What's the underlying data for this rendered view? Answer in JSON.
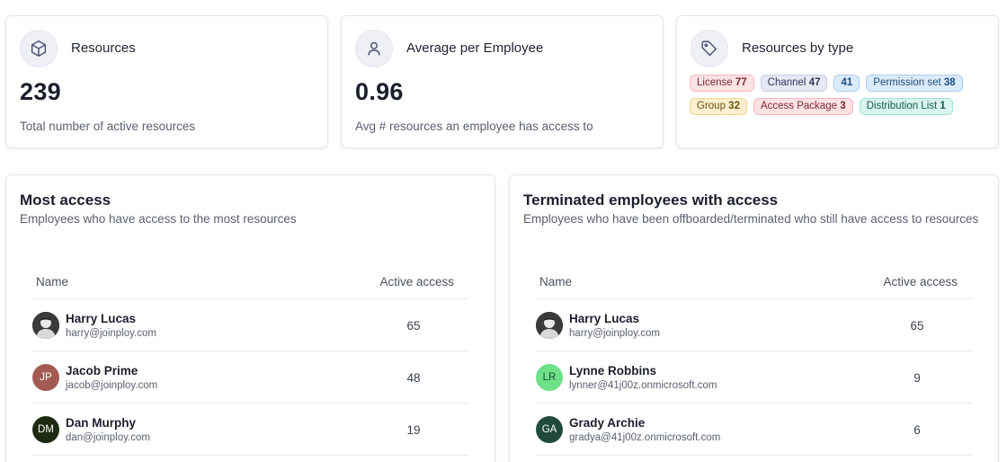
{
  "stats": [
    {
      "title": "Resources",
      "value": "239",
      "desc": "Total number of active resources",
      "icon": "cube-icon"
    },
    {
      "title": "Average per Employee",
      "value": "0.96",
      "desc": "Avg # resources an employee has access to",
      "icon": "user-icon"
    }
  ],
  "by_type": {
    "title": "Resources by type",
    "icon": "tag-icon",
    "badges": [
      {
        "label": "License",
        "count": "77",
        "bg": "#fde2e4",
        "border": "#f4b8bf",
        "color": "#7a2a33"
      },
      {
        "label": "Channel",
        "count": "47",
        "bg": "#e6e8f4",
        "border": "#c8cde6",
        "color": "#2f3659"
      },
      {
        "label": "",
        "count": "41",
        "bg": "#dcebfb",
        "border": "#a9cdf2",
        "color": "#1e4d80"
      },
      {
        "label": "Permission set",
        "count": "38",
        "bg": "#dcebfb",
        "border": "#a9cdf2",
        "color": "#1e4d80"
      },
      {
        "label": "Group",
        "count": "32",
        "bg": "#fdf0cf",
        "border": "#f1d58a",
        "color": "#6d5210"
      },
      {
        "label": "Access Package",
        "count": "3",
        "bg": "#fde2e4",
        "border": "#f4b8bf",
        "color": "#7a2a33"
      },
      {
        "label": "Distribution List",
        "count": "1",
        "bg": "#d8f5ee",
        "border": "#9fe3d1",
        "color": "#185c4c"
      }
    ]
  },
  "most_access": {
    "title": "Most access",
    "subtitle": "Employees who have access to the most resources",
    "col_name": "Name",
    "col_access": "Active access",
    "rows": [
      {
        "name": "Harry Lucas",
        "email": "harry@joinploy.com",
        "count": "65",
        "initials": "",
        "avatar_color": "#2b2b2b",
        "photo": true
      },
      {
        "name": "Jacob Prime",
        "email": "jacob@joinploy.com",
        "count": "48",
        "initials": "JP",
        "avatar_color": "#a25a52",
        "photo": false
      },
      {
        "name": "Dan Murphy",
        "email": "dan@joinploy.com",
        "count": "19",
        "initials": "DM",
        "avatar_color": "#1f2a12",
        "photo": false
      }
    ]
  },
  "terminated": {
    "title": "Terminated employees with access",
    "subtitle": "Employees who have been offboarded/terminated who still have access to resources",
    "col_name": "Name",
    "col_access": "Active access",
    "rows": [
      {
        "name": "Harry Lucas",
        "email": "harry@joinploy.com",
        "count": "65",
        "initials": "",
        "avatar_color": "#2b2b2b",
        "photo": true
      },
      {
        "name": "Lynne Robbins",
        "email": "lynner@41j00z.onmicrosoft.com",
        "count": "9",
        "initials": "LR",
        "avatar_color": "#6ee08a",
        "photo": false
      },
      {
        "name": "Grady Archie",
        "email": "gradya@41j00z.onmicrosoft.com",
        "count": "6",
        "initials": "GA",
        "avatar_color": "#1f4a3c",
        "photo": false
      }
    ]
  }
}
